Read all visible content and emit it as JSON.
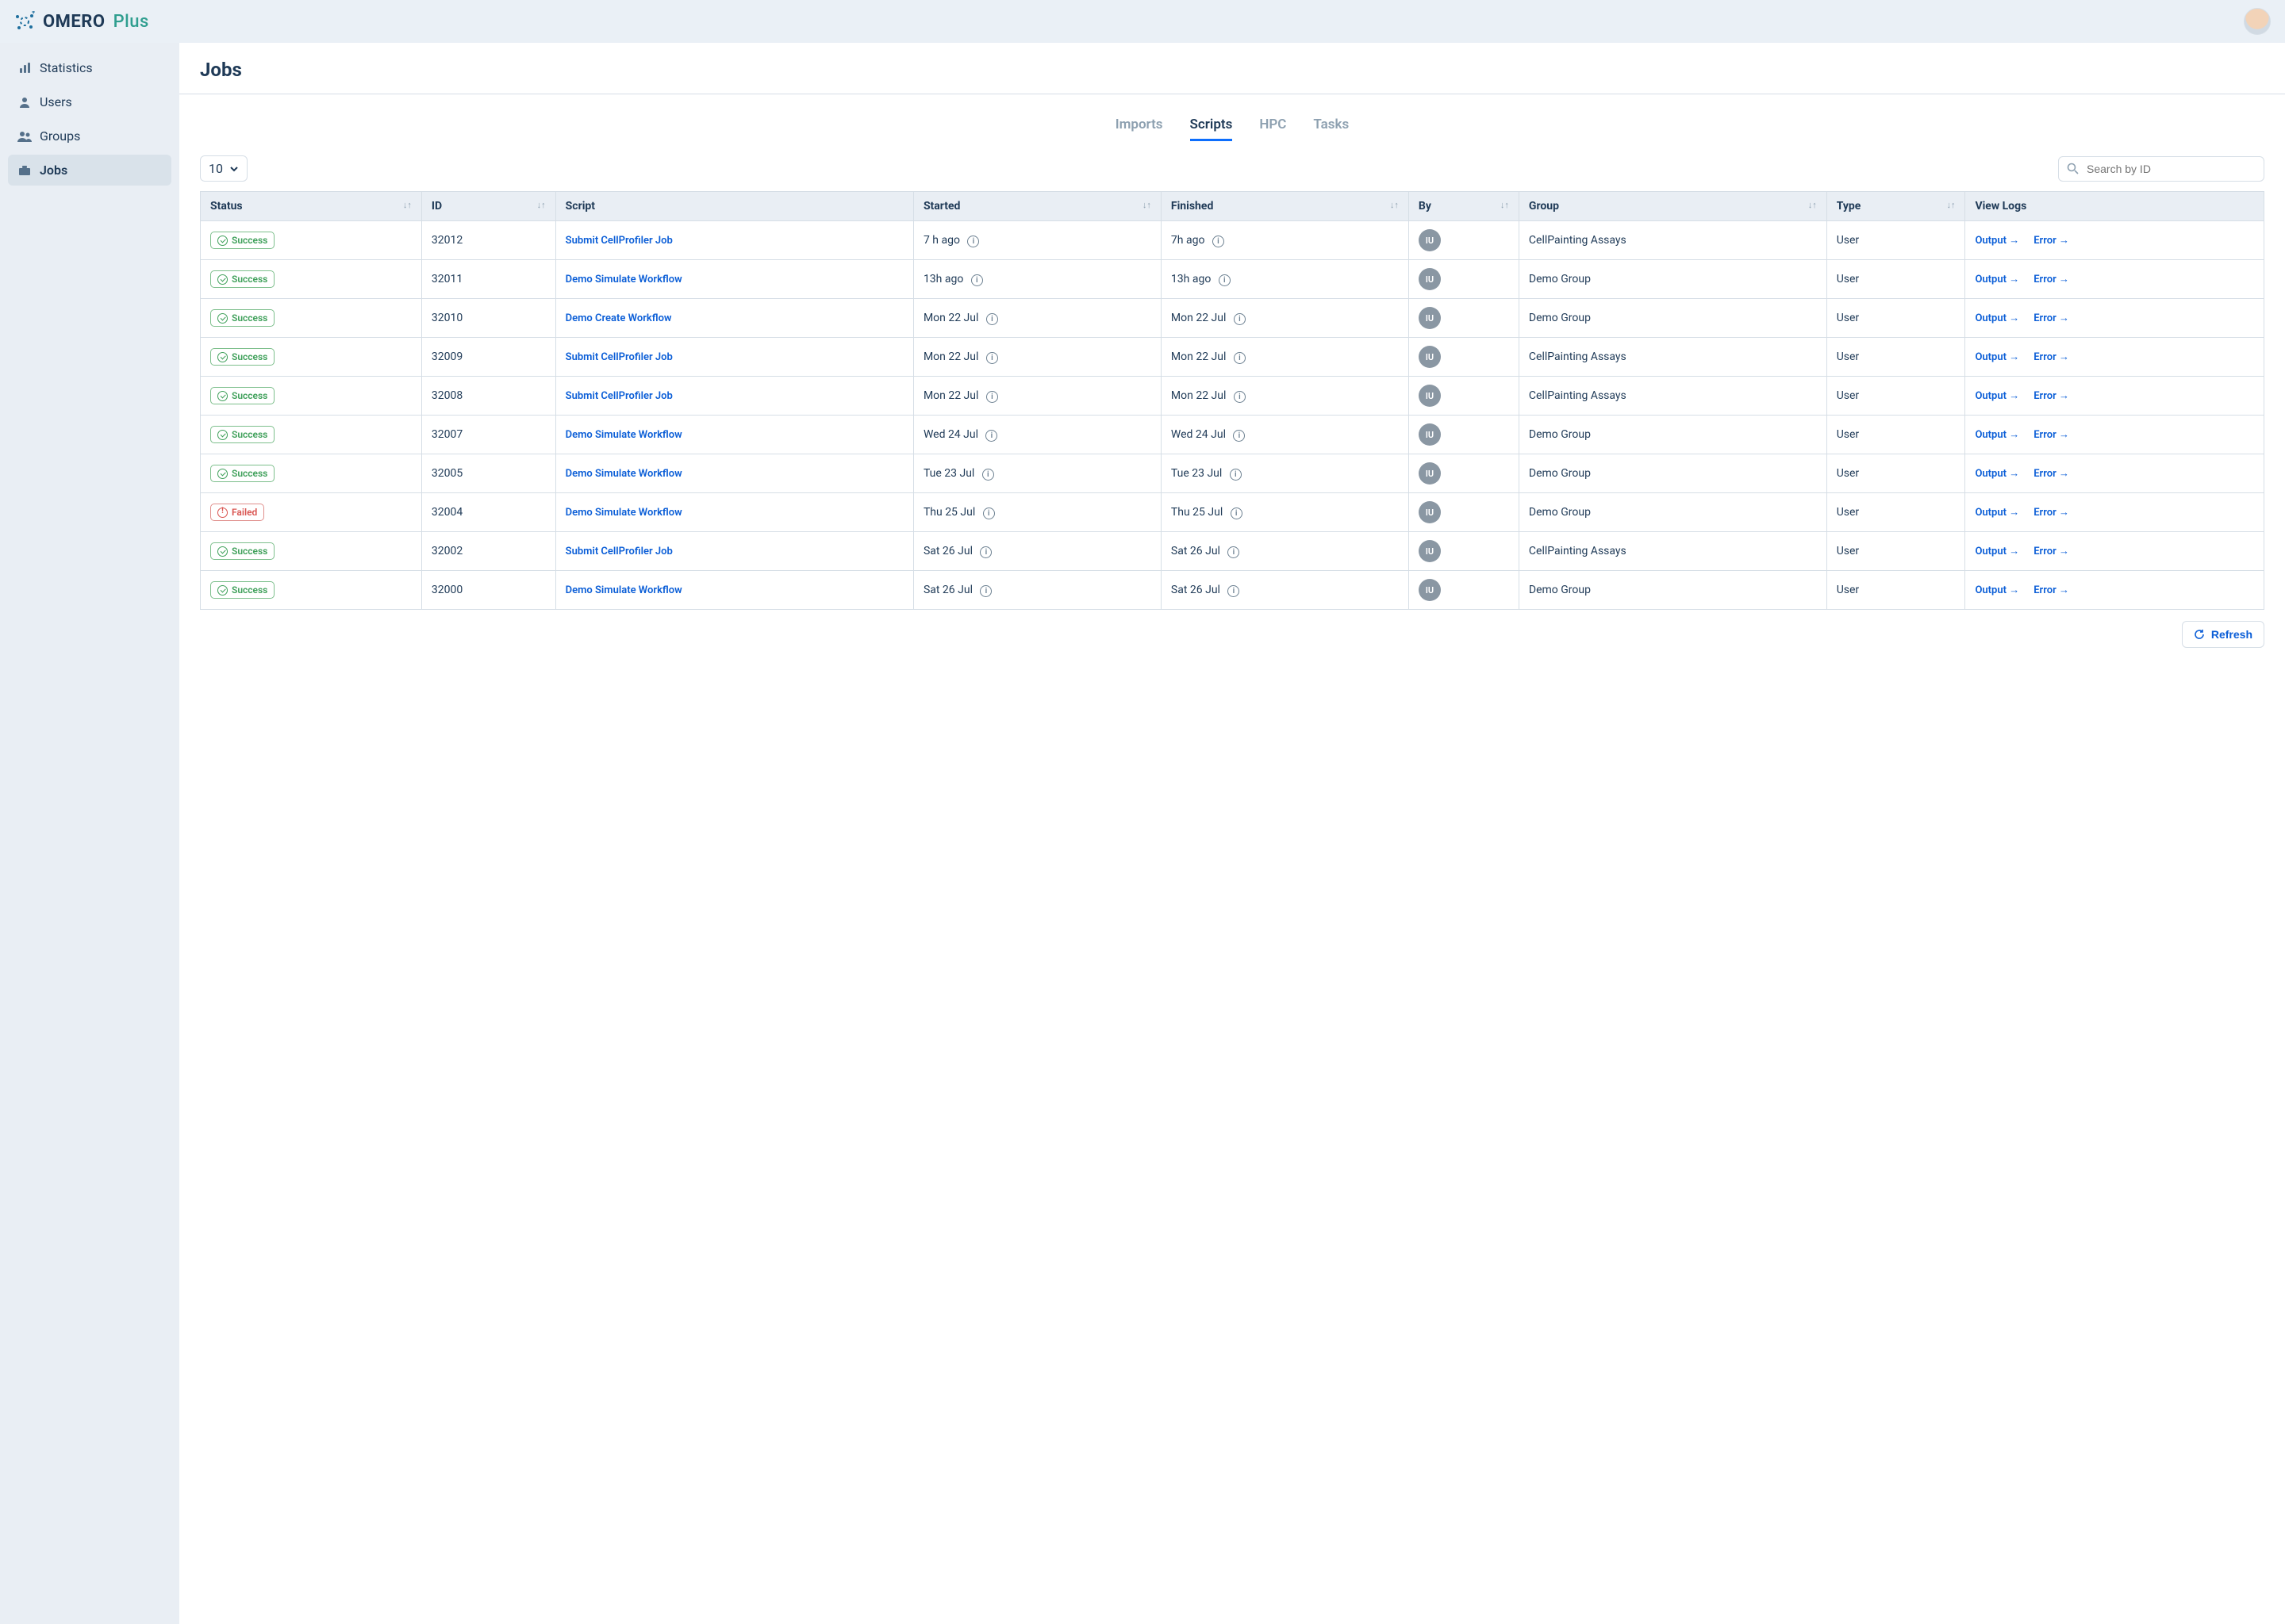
{
  "brand": {
    "name": "OMERO",
    "suffix": "Plus"
  },
  "sidebar": {
    "items": [
      {
        "label": "Statistics"
      },
      {
        "label": "Users"
      },
      {
        "label": "Groups"
      },
      {
        "label": "Jobs"
      }
    ]
  },
  "page": {
    "title": "Jobs"
  },
  "tabs": {
    "items": [
      {
        "label": "Imports"
      },
      {
        "label": "Scripts"
      },
      {
        "label": "HPC"
      },
      {
        "label": "Tasks"
      }
    ]
  },
  "toolbar": {
    "page_size": "10",
    "search_placeholder": "Search by ID"
  },
  "columns": {
    "status": "Status",
    "id": "ID",
    "script": "Script",
    "started": "Started",
    "finished": "Finished",
    "by": "By",
    "group": "Group",
    "type": "Type",
    "viewlogs": "View Logs"
  },
  "log_labels": {
    "output": "Output →",
    "error": "Error →"
  },
  "status_labels": {
    "success": "Success",
    "failed": "Failed"
  },
  "refresh_label": "Refresh",
  "rows": [
    {
      "status": "success",
      "id": "32012",
      "script": "Submit CellProfiler Job",
      "started": "7 h ago",
      "finished": "7h ago",
      "by": "IU",
      "group": "CellPainting Assays",
      "type": "User"
    },
    {
      "status": "success",
      "id": "32011",
      "script": "Demo Simulate Workflow",
      "started": "13h ago",
      "finished": "13h ago",
      "by": "IU",
      "group": "Demo Group",
      "type": "User"
    },
    {
      "status": "success",
      "id": "32010",
      "script": "Demo Create Workflow",
      "started": "Mon 22 Jul",
      "finished": "Mon 22 Jul",
      "by": "IU",
      "group": "Demo Group",
      "type": "User"
    },
    {
      "status": "success",
      "id": "32009",
      "script": "Submit CellProfiler Job",
      "started": "Mon 22 Jul",
      "finished": "Mon 22 Jul",
      "by": "IU",
      "group": "CellPainting Assays",
      "type": "User"
    },
    {
      "status": "success",
      "id": "32008",
      "script": "Submit CellProfiler Job",
      "started": "Mon 22 Jul",
      "finished": "Mon 22 Jul",
      "by": "IU",
      "group": "CellPainting Assays",
      "type": "User"
    },
    {
      "status": "success",
      "id": "32007",
      "script": "Demo Simulate Workflow",
      "started": "Wed 24 Jul",
      "finished": "Wed 24 Jul",
      "by": "IU",
      "group": "Demo Group",
      "type": "User"
    },
    {
      "status": "success",
      "id": "32005",
      "script": "Demo Simulate Workflow",
      "started": "Tue 23 Jul",
      "finished": "Tue 23 Jul",
      "by": "IU",
      "group": "Demo Group",
      "type": "User"
    },
    {
      "status": "failed",
      "id": "32004",
      "script": "Demo Simulate Workflow",
      "started": "Thu 25 Jul",
      "finished": "Thu 25 Jul",
      "by": "IU",
      "group": "Demo Group",
      "type": "User"
    },
    {
      "status": "success",
      "id": "32002",
      "script": "Submit CellProfiler Job",
      "started": "Sat 26 Jul",
      "finished": "Sat 26 Jul",
      "by": "IU",
      "group": "CellPainting Assays",
      "type": "User"
    },
    {
      "status": "success",
      "id": "32000",
      "script": "Demo Simulate Workflow",
      "started": "Sat 26 Jul",
      "finished": "Sat 26 Jul",
      "by": "IU",
      "group": "Demo Group",
      "type": "User"
    }
  ]
}
